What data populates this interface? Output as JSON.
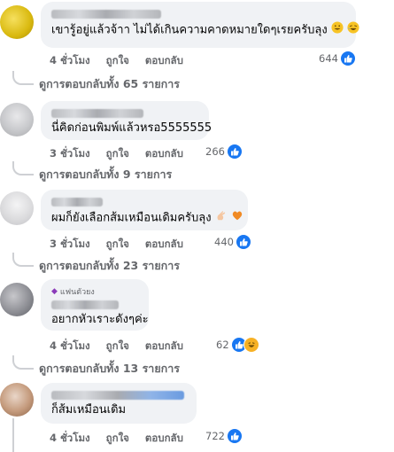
{
  "comments": [
    {
      "text": "เขารู้อยู่แล้วจ้าา ไม่ได้เกินความคาดหมายใดๆเรยครับลุง",
      "time": "4 ชั่วโมง",
      "like_label": "ถูกใจ",
      "reply_label": "ตอบกลับ",
      "reaction_count": "644",
      "view_replies": "ดูการตอบกลับทั้ง 65 รายการ"
    },
    {
      "text": "นี่คิดก่อนพิมพ์แล้วหรอ5555555",
      "time": "3 ชั่วโมง",
      "like_label": "ถูกใจ",
      "reply_label": "ตอบกลับ",
      "reaction_count": "266",
      "view_replies": "ดูการตอบกลับทั้ง 9 รายการ"
    },
    {
      "text": "ผมก็ยังเลือกส้มเหมือนเดิมครับลุง",
      "time": "3 ชั่วโมง",
      "like_label": "ถูกใจ",
      "reply_label": "ตอบกลับ",
      "reaction_count": "440",
      "view_replies": "ดูการตอบกลับทั้ง 23 รายการ"
    },
    {
      "badge": "แฟนตัวยง",
      "text": "อยากหัวเราะดังๆค่ะ",
      "time": "4 ชั่วโมง",
      "like_label": "ถูกใจ",
      "reply_label": "ตอบกลับ",
      "reaction_count": "62",
      "view_replies": "ดูการตอบกลับทั้ง 13 รายการ"
    },
    {
      "text": "ก็ส้มเหมือนเดิม",
      "time": "4 ชั่วโมง",
      "like_label": "ถูกใจ",
      "reply_label": "ตอบกลับ",
      "reaction_count": "722"
    }
  ],
  "colors": {
    "like_blue": "#1877f2",
    "haha_yellow": "#f7b125",
    "bubble_bg": "#f0f2f5",
    "meta_gray": "#65676b"
  }
}
